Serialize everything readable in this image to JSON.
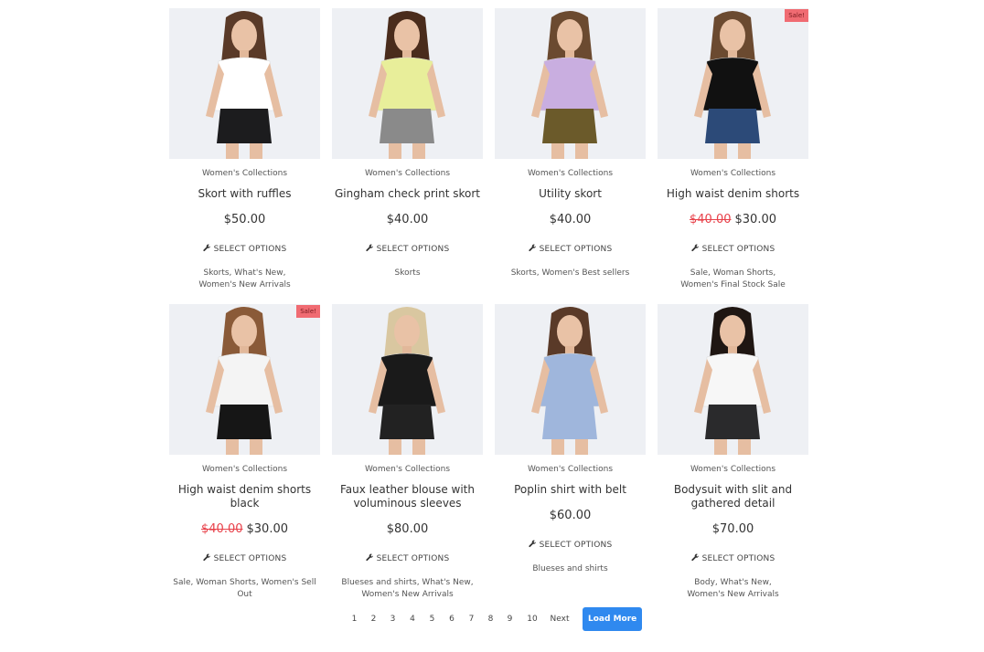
{
  "products": [
    {
      "category": "Women's Collections",
      "title": "Skort with ruffles",
      "price": "$50.00",
      "old_price": "",
      "sale": "",
      "select_label": "SELECT OPTIONS",
      "tags": "Skorts, What's New,\nWomen's New Arrivals",
      "top_color": "#ffffff",
      "bottom_color": "#1c1c1e",
      "hair": "#5a3a28",
      "image_alt": "woman in white top and black ruffle skort"
    },
    {
      "category": "Women's Collections",
      "title": "Gingham check print skort",
      "price": "$40.00",
      "old_price": "",
      "sale": "",
      "select_label": "SELECT OPTIONS",
      "tags": "Skorts",
      "top_color": "#e8ee9a",
      "bottom_color": "#8a8a8a",
      "hair": "#4a2c1c",
      "image_alt": "woman in yellow top and gingham skort"
    },
    {
      "category": "Women's Collections",
      "title": "Utility skort",
      "price": "$40.00",
      "old_price": "",
      "sale": "",
      "select_label": "SELECT OPTIONS",
      "tags": "Skorts, Women's Best sellers",
      "top_color": "#c9aee0",
      "bottom_color": "#6b5a2a",
      "hair": "#6b4a30",
      "image_alt": "woman in lilac sweatshirt and plaid skort"
    },
    {
      "category": "Women's Collections",
      "title": "High waist denim shorts",
      "price": "$30.00",
      "old_price": "$40.00",
      "sale": "Sale!",
      "select_label": "SELECT OPTIONS",
      "tags": "Sale, Woman Shorts,\nWomen's Final Stock Sale",
      "top_color": "#111111",
      "bottom_color": "#2c4a78",
      "hair": "#6b4a30",
      "image_alt": "woman in black crop top and denim shorts"
    },
    {
      "category": "Women's Collections",
      "title": "High waist denim shorts black",
      "price": "$30.00",
      "old_price": "$40.00",
      "sale": "Sale!",
      "select_label": "SELECT OPTIONS",
      "tags": "Sale, Woman Shorts, Women's Sell Out",
      "top_color": "#f4f4f4",
      "bottom_color": "#161616",
      "hair": "#8a5a38",
      "image_alt": "woman in white tee and black denim shorts"
    },
    {
      "category": "Women's Collections",
      "title": "Faux leather blouse with voluminous sleeves",
      "price": "$80.00",
      "old_price": "",
      "sale": "",
      "select_label": "SELECT OPTIONS",
      "tags": "Blueses and shirts, What's New,\nWomen's New Arrivals",
      "top_color": "#1a1a1a",
      "bottom_color": "#222222",
      "hair": "#d9c7a0",
      "image_alt": "woman in black leather blouse"
    },
    {
      "category": "Women's Collections",
      "title": "Poplin shirt with belt",
      "price": "$60.00",
      "old_price": "",
      "sale": "",
      "select_label": "SELECT OPTIONS",
      "tags": "Blueses and shirts",
      "top_color": "#9fb6dc",
      "bottom_color": "#9fb6dc",
      "hair": "#5a3a28",
      "image_alt": "woman in striped blue poplin shirt dress"
    },
    {
      "category": "Women's Collections",
      "title": "Bodysuit with slit and gathered detail",
      "price": "$70.00",
      "old_price": "",
      "sale": "",
      "select_label": "SELECT OPTIONS",
      "tags": "Body, What's New,\nWomen's New Arrivals",
      "top_color": "#f7f7f7",
      "bottom_color": "#2a2a2c",
      "hair": "#1f1612",
      "image_alt": "woman in white bodysuit and dark skirt"
    }
  ],
  "pagination": {
    "pages": [
      "1",
      "2",
      "3",
      "4",
      "5",
      "6",
      "7",
      "8",
      "9",
      "10"
    ],
    "next_label": "Next",
    "load_more_label": "Load More"
  },
  "colors": {
    "accent": "#2f89ef",
    "sale_badge": "#f06b72",
    "old_price": "#e8414a",
    "image_bg": "#eef0f4"
  }
}
